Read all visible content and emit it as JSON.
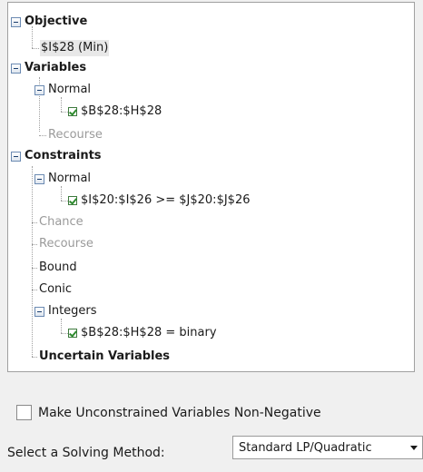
{
  "tree": {
    "objective": {
      "label": "Objective",
      "cell": "$I$28 (Min)"
    },
    "variables": {
      "label": "Variables",
      "normal": {
        "label": "Normal",
        "item": "$B$28:$H$28"
      },
      "recourse": "Recourse"
    },
    "constraints": {
      "label": "Constraints",
      "normal": {
        "label": "Normal",
        "item": "$I$20:$I$26 >= $J$20:$J$26"
      },
      "chance": "Chance",
      "recourse": "Recourse",
      "bound": "Bound",
      "conic": "Conic",
      "integers": {
        "label": "Integers",
        "item": "$B$28:$H$28 = binary"
      }
    },
    "uncertain_variables": "Uncertain Variables"
  },
  "options": {
    "nonnegative_label": "Make Unconstrained Variables Non-Negative",
    "nonnegative_checked": false
  },
  "solving_method": {
    "label": "Select a Solving Method:",
    "selected": "Standard LP/Quadratic"
  },
  "colors": {
    "check_green": "#2e8b2e",
    "toggle_blue": "#6b8ab2",
    "disabled_gray": "#9a9a9a"
  }
}
